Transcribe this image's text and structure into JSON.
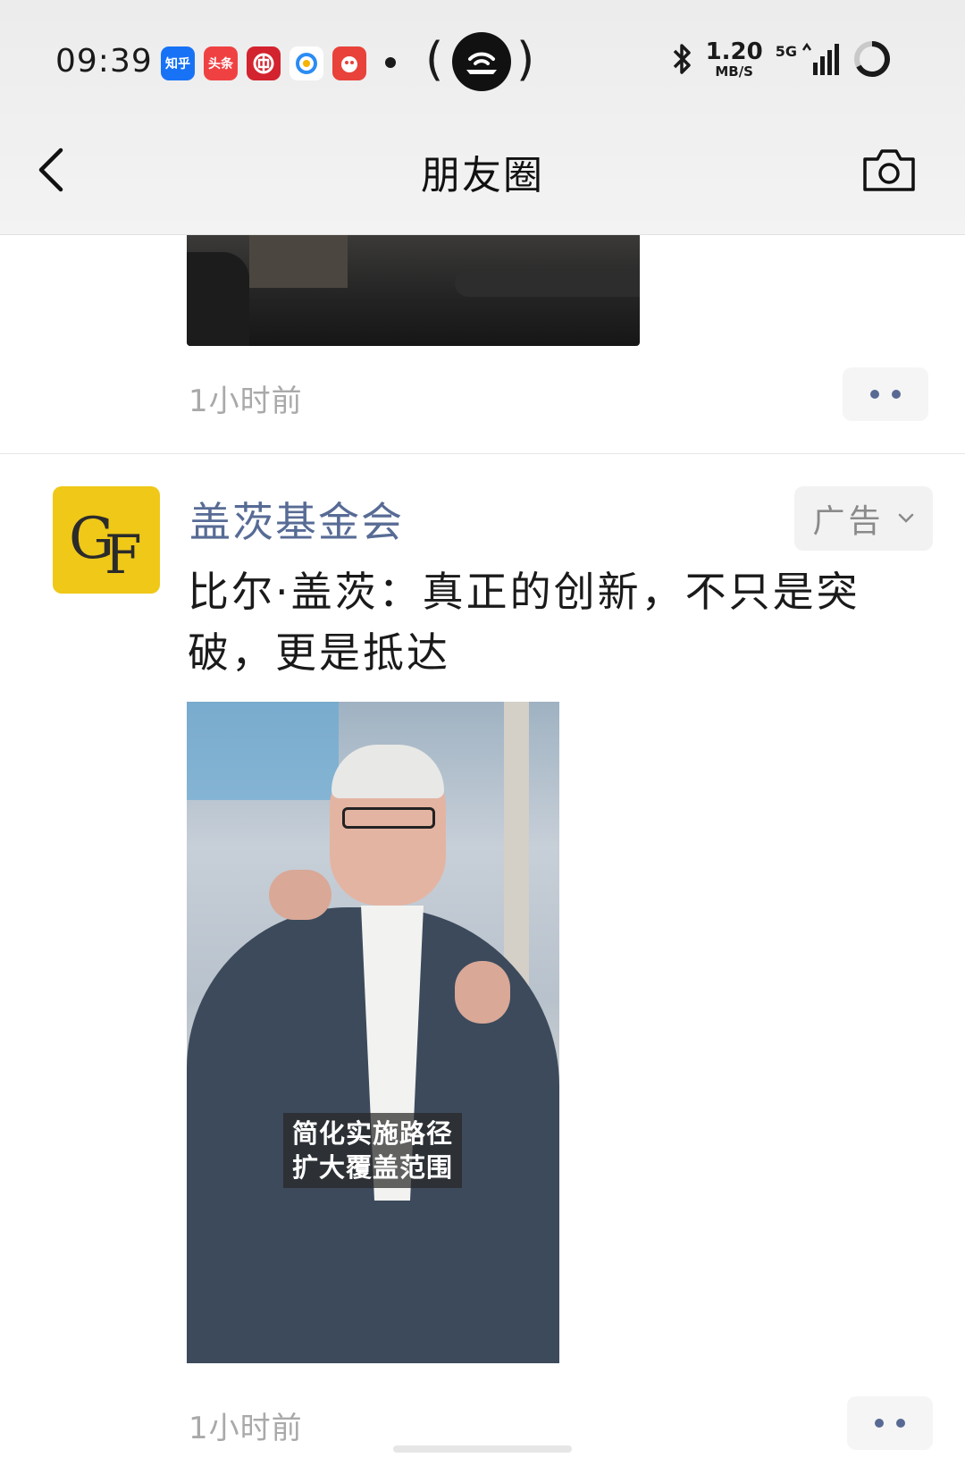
{
  "status_bar": {
    "time": "09:39",
    "apps": [
      {
        "label": "知乎",
        "color": "#1772f6"
      },
      {
        "label": "头条",
        "color": "#f04142"
      },
      {
        "label": "",
        "color": "#d3232e"
      },
      {
        "label": "",
        "color": "#ffffff"
      },
      {
        "label": "",
        "color": "#e8423a"
      }
    ],
    "net_speed_value": "1.20",
    "net_speed_unit": "MB/S",
    "network_type": "5G"
  },
  "nav": {
    "title": "朋友圈",
    "back_icon": "chevron-left-icon",
    "camera_icon": "camera-icon"
  },
  "previous_post": {
    "timestamp": "1小时前"
  },
  "post": {
    "avatar_letters": {
      "first": "G",
      "second": "F"
    },
    "avatar_color": "#efc818",
    "author": "盖茨基金会",
    "ad_label": "广告",
    "text": "比尔·盖茨：真正的创新，不只是突破，更是抵达",
    "video_caption_line1": "简化实施路径",
    "video_caption_line2": "扩大覆盖范围",
    "timestamp": "1小时前"
  },
  "colors": {
    "link_blue": "#576b95",
    "timestamp_gray": "#a9a9a9"
  }
}
